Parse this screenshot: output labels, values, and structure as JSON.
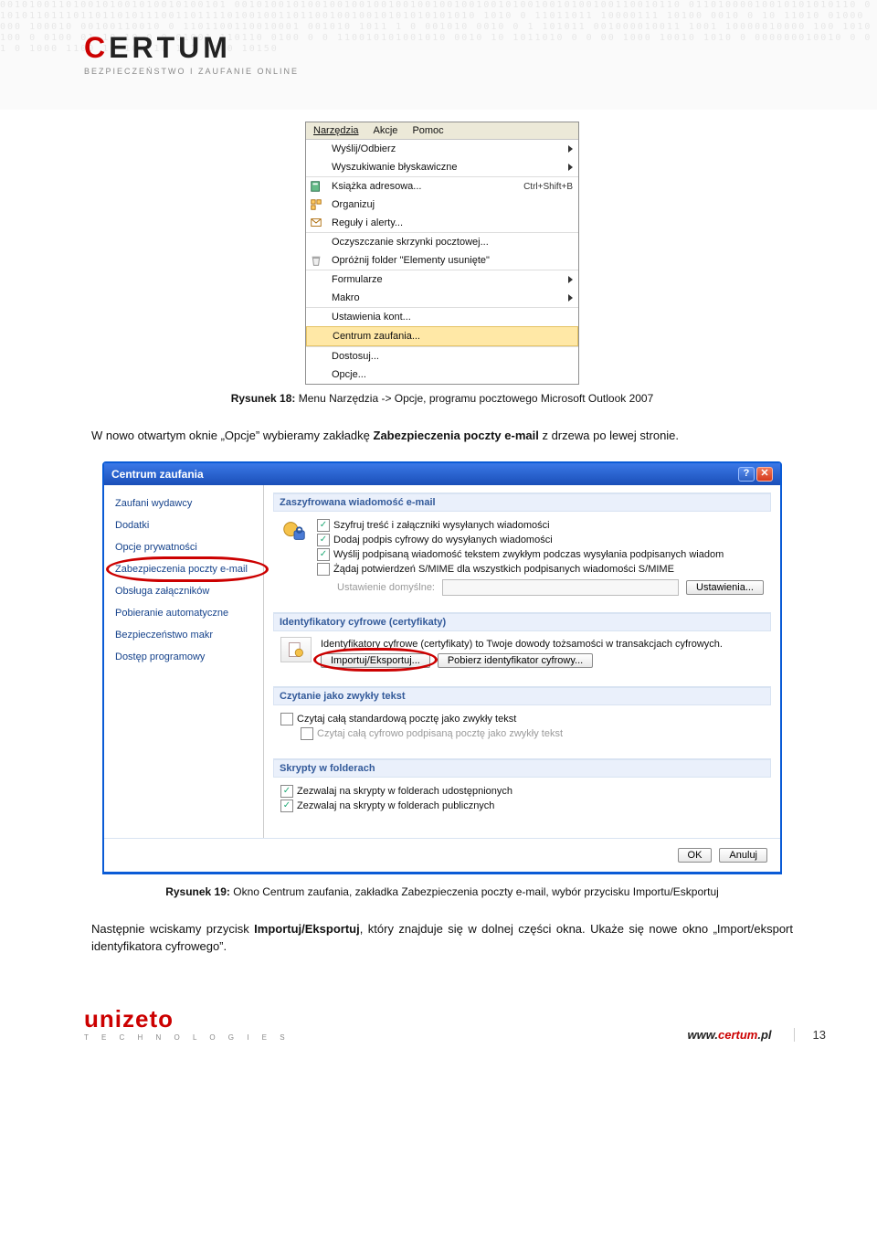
{
  "logo": {
    "part1": "C",
    "part2": "ERTUM",
    "tag": "BEZPIECZEŃSTWO I ZAUFANIE ONLINE"
  },
  "menu": {
    "bar": [
      "Narzędzia",
      "Akcje",
      "Pomoc"
    ],
    "items": [
      {
        "label": "Wyślij/Odbierz",
        "submenu": true
      },
      {
        "label": "Wyszukiwanie błyskawiczne",
        "submenu": true,
        "sep": true
      },
      {
        "label": "Książka adresowa...",
        "shortcut": "Ctrl+Shift+B",
        "icon": "book",
        "sep": true
      },
      {
        "label": "Organizuj",
        "icon": "organize"
      },
      {
        "label": "Reguły i alerty...",
        "icon": "rules"
      },
      {
        "label": "Oczyszczanie skrzynki pocztowej...",
        "sep": true
      },
      {
        "label": "Opróżnij folder \"Elementy usunięte\"",
        "icon": "trash"
      },
      {
        "label": "Formularze",
        "submenu": true,
        "sep": true
      },
      {
        "label": "Makro",
        "submenu": true
      },
      {
        "label": "Ustawienia kont...",
        "sep": true
      },
      {
        "label": "Centrum zaufania...",
        "highlight": true
      },
      {
        "label": "Dostosuj...",
        "sep": true
      },
      {
        "label": "Opcje..."
      }
    ]
  },
  "caption1": {
    "lbl": "Rysunek 18: ",
    "txt": "Menu Narzędzia -> Opcje,  programu pocztowego Microsoft Outlook 2007"
  },
  "para1a": "W nowo otwartym oknie „Opcje” wybieramy zakładkę ",
  "para1b": "Zabezpieczenia poczty e-mail",
  "para1c": " z drzewa po lewej stronie.",
  "dlg": {
    "title": "Centrum zaufania",
    "nav": [
      "Zaufani wydawcy",
      "Dodatki",
      "Opcje prywatności",
      "Zabezpieczenia poczty e-mail",
      "Obsługa załączników",
      "Pobieranie automatyczne",
      "Bezpieczeństwo makr",
      "Dostęp programowy"
    ],
    "grp1": {
      "h": "Zaszyfrowana wiadomość e-mail",
      "c1": "Szyfruj treść i załączniki wysyłanych wiadomości",
      "c2": "Dodaj podpis cyfrowy do wysyłanych wiadomości",
      "c3": "Wyślij podpisaną wiadomość tekstem zwykłym podczas wysyłania podpisanych wiadom",
      "c4": "Żądaj potwierdzeń S/MIME dla wszystkich podpisanych wiadomości S/MIME",
      "lbl": "Ustawienie domyślne:",
      "btn": "Ustawienia..."
    },
    "grp2": {
      "h": "Identyfikatory cyfrowe (certyfikaty)",
      "txt": "Identyfikatory cyfrowe (certyfikaty) to Twoje dowody tożsamości w transakcjach cyfrowych.",
      "b1": "Importuj/Eksportuj...",
      "b2": "Pobierz identyfikator cyfrowy..."
    },
    "grp3": {
      "h": "Czytanie jako zwykły tekst",
      "c1": "Czytaj całą standardową pocztę jako zwykły tekst",
      "c2": "Czytaj całą cyfrowo podpisaną pocztę jako zwykły tekst"
    },
    "grp4": {
      "h": "Skrypty w folderach",
      "c1": "Zezwalaj na skrypty w folderach udostępnionych",
      "c2": "Zezwalaj na skrypty w folderach publicznych"
    },
    "ok": "OK",
    "cancel": "Anuluj"
  },
  "caption2": {
    "lbl": "Rysunek 19: ",
    "txt": "Okno Centrum zaufania, zakładka Zabezpieczenia poczty e-mail, wybór przycisku Importu/Eskportuj"
  },
  "para2a": "Następnie wciskamy przycisk ",
  "para2b": "Importuj/Eksportuj",
  "para2c": ", który znajduje się w dolnej części okna. Ukaże się nowe okno „Import/eksport identyfikatora cyfrowego”.",
  "footer": {
    "unizeto": "unizeto",
    "unizeto_tag": "T E C H N O L O G I E S",
    "url1": "www.",
    "url2": "certum",
    "url3": ".pl",
    "page": "13"
  },
  "noise": "0010100110100101001010010100101  0010100101001001001001001001001001001010010010100100110010110 01101000010010101010110  010101101110110110101110011011110100100110110010010010101010101010 1010 0 11011011 10000111 10100  0010 0 10 11010 01000 000 100010  00100110010 0 1101100110010001  001010 1011  1 0 001010 0010  0 1 101011  001000010011  1001 10000010000 100 1010  100  0 0100 01   10 10 0  0 01001  110110 0100 0 0 110010101001010 0010 10  1011010 0  0 00 1000  10010 1010  0 000000010010 0 01 0  1000 1100  10 100 10 1 1 1000 10150"
}
